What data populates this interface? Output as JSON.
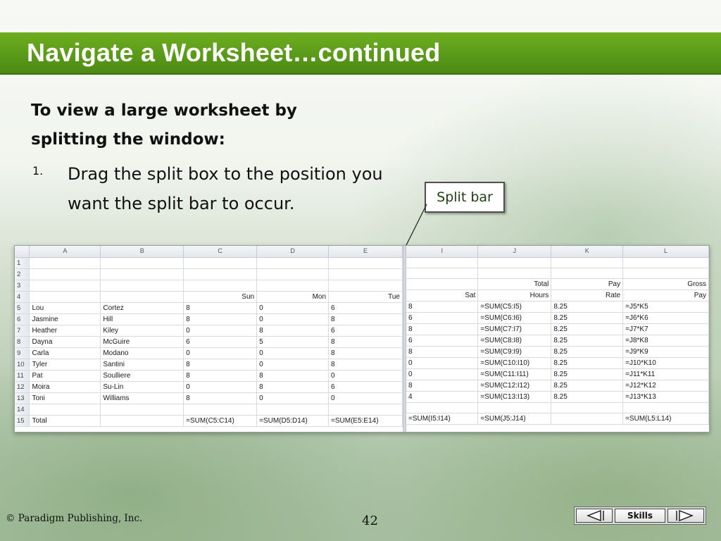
{
  "slide": {
    "title": "Navigate a Worksheet…continued",
    "heading": "To view a large worksheet by splitting the window:",
    "step_number": "1.",
    "step_text": "Drag the split box to the position you want the split bar to occur.",
    "callout_label": "Split bar"
  },
  "spreadsheet": {
    "left_columns": [
      "A",
      "B",
      "C",
      "D",
      "E"
    ],
    "right_columns": [
      "I",
      "J",
      "K",
      "L"
    ],
    "row_numbers": [
      "1",
      "2",
      "3",
      "4",
      "5",
      "6",
      "7",
      "8",
      "9",
      "10",
      "11",
      "12",
      "13",
      "14",
      "15"
    ],
    "left_rows": [
      [
        "",
        "",
        "",
        "",
        ""
      ],
      [
        "",
        "",
        "",
        "",
        ""
      ],
      [
        "",
        "",
        "",
        "",
        ""
      ],
      [
        "",
        "",
        "Sun",
        "Mon",
        "Tue"
      ],
      [
        "Lou",
        "Cortez",
        "8",
        "0",
        "6"
      ],
      [
        "Jasmine",
        "Hill",
        "8",
        "0",
        "8"
      ],
      [
        "Heather",
        "Kiley",
        "0",
        "8",
        "6"
      ],
      [
        "Dayna",
        "McGuire",
        "6",
        "5",
        "8"
      ],
      [
        "Carla",
        "Modano",
        "0",
        "0",
        "8"
      ],
      [
        "Tyler",
        "Santini",
        "8",
        "0",
        "8"
      ],
      [
        "Pat",
        "Soulliere",
        "8",
        "8",
        "0"
      ],
      [
        "Moira",
        "Su-Lin",
        "0",
        "8",
        "6"
      ],
      [
        "Toni",
        "Williams",
        "8",
        "0",
        "0"
      ],
      [
        "",
        "",
        "",
        "",
        ""
      ],
      [
        "Total",
        "",
        "=SUM(C5:C14)",
        "=SUM(D5:D14)",
        "=SUM(E5:E14)"
      ]
    ],
    "right_rows": [
      [
        "",
        "",
        "",
        ""
      ],
      [
        "",
        "",
        "",
        ""
      ],
      [
        "",
        "Total",
        "Pay",
        "Gross"
      ],
      [
        "Sat",
        "Hours",
        "Rate",
        "Pay"
      ],
      [
        "8",
        "=SUM(C5:I5)",
        "8.25",
        "=J5*K5"
      ],
      [
        "6",
        "=SUM(C6:I6)",
        "8.25",
        "=J6*K6"
      ],
      [
        "8",
        "=SUM(C7:I7)",
        "8.25",
        "=J7*K7"
      ],
      [
        "6",
        "=SUM(C8:I8)",
        "8.25",
        "=J8*K8"
      ],
      [
        "8",
        "=SUM(C9:I9)",
        "8.25",
        "=J9*K9"
      ],
      [
        "0",
        "=SUM(C10:I10)",
        "8.25",
        "=J10*K10"
      ],
      [
        "0",
        "=SUM(C11:I11)",
        "8.25",
        "=J11*K11"
      ],
      [
        "8",
        "=SUM(C12:I12)",
        "8.25",
        "=J12*K12"
      ],
      [
        "4",
        "=SUM(C13:I13)",
        "8.25",
        "=J13*K13"
      ],
      [
        "",
        "",
        "",
        ""
      ],
      [
        "=SUM(I5:I14)",
        "=SUM(J5:J14)",
        "",
        "=SUM(L5:L14)"
      ]
    ]
  },
  "footer": {
    "copyright": "© Paradigm Publishing, Inc.",
    "page_number": "42",
    "skills_label": "Skills"
  }
}
